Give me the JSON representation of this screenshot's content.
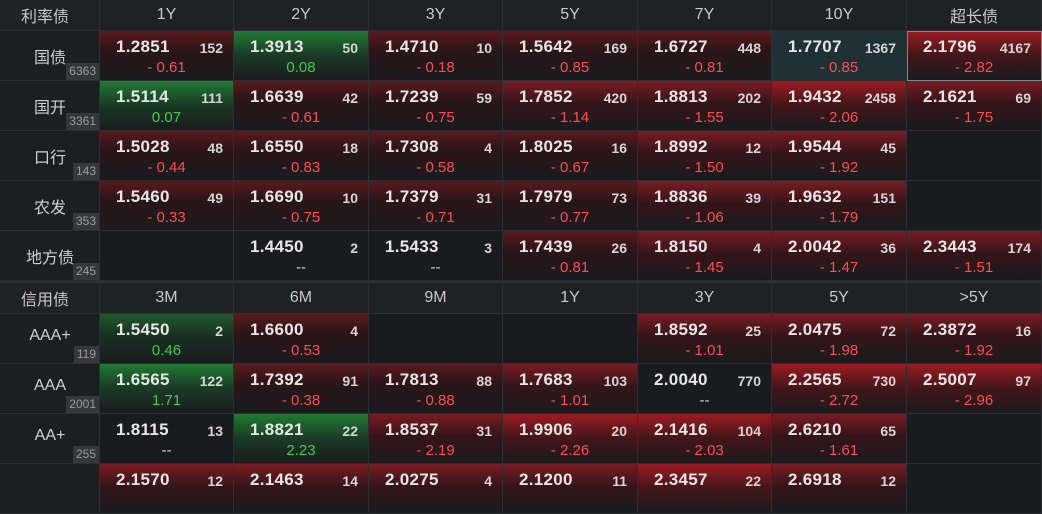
{
  "rate": {
    "title": "利率债",
    "tenors": [
      "1Y",
      "2Y",
      "3Y",
      "5Y",
      "7Y",
      "10Y",
      "超长债"
    ],
    "rows": [
      {
        "name": "国债",
        "count": "6363",
        "cells": [
          {
            "y": "1.2851",
            "v": "152",
            "c": "- 0.61",
            "d": "neg",
            "bg": "r1"
          },
          {
            "y": "1.3913",
            "v": "50",
            "c": "0.08",
            "d": "pos",
            "bg": "g2"
          },
          {
            "y": "1.4710",
            "v": "10",
            "c": "- 0.18",
            "d": "neg",
            "bg": "r1"
          },
          {
            "y": "1.5642",
            "v": "169",
            "c": "- 0.85",
            "d": "neg",
            "bg": "r1"
          },
          {
            "y": "1.6727",
            "v": "448",
            "c": "- 0.81",
            "d": "neg",
            "bg": "r1"
          },
          {
            "y": "1.7707",
            "v": "1367",
            "c": "- 0.85",
            "d": "neg",
            "bg": "r3t"
          },
          {
            "y": "2.1796",
            "v": "4167",
            "c": "- 2.82",
            "d": "neg",
            "bg": "r3s"
          }
        ]
      },
      {
        "name": "国开",
        "count": "3361",
        "cells": [
          {
            "y": "1.5114",
            "v": "111",
            "c": "0.07",
            "d": "pos",
            "bg": "g2"
          },
          {
            "y": "1.6639",
            "v": "42",
            "c": "- 0.61",
            "d": "neg",
            "bg": "r1"
          },
          {
            "y": "1.7239",
            "v": "59",
            "c": "- 0.75",
            "d": "neg",
            "bg": "r1"
          },
          {
            "y": "1.7852",
            "v": "420",
            "c": "- 1.14",
            "d": "neg",
            "bg": "r2"
          },
          {
            "y": "1.8813",
            "v": "202",
            "c": "- 1.55",
            "d": "neg",
            "bg": "r2"
          },
          {
            "y": "1.9432",
            "v": "2458",
            "c": "- 2.06",
            "d": "neg",
            "bg": "r3"
          },
          {
            "y": "2.1621",
            "v": "69",
            "c": "- 1.75",
            "d": "neg",
            "bg": "r2"
          }
        ]
      },
      {
        "name": "口行",
        "count": "143",
        "cells": [
          {
            "y": "1.5028",
            "v": "48",
            "c": "- 0.44",
            "d": "neg",
            "bg": "r1"
          },
          {
            "y": "1.6550",
            "v": "18",
            "c": "- 0.83",
            "d": "neg",
            "bg": "r1"
          },
          {
            "y": "1.7308",
            "v": "4",
            "c": "- 0.58",
            "d": "neg",
            "bg": "r1"
          },
          {
            "y": "1.8025",
            "v": "16",
            "c": "- 0.67",
            "d": "neg",
            "bg": "r1"
          },
          {
            "y": "1.8992",
            "v": "12",
            "c": "- 1.50",
            "d": "neg",
            "bg": "r2"
          },
          {
            "y": "1.9544",
            "v": "45",
            "c": "- 1.92",
            "d": "neg",
            "bg": "r2"
          },
          {
            "y": "",
            "v": "",
            "c": "",
            "d": "nil",
            "bg": "n"
          }
        ]
      },
      {
        "name": "农发",
        "count": "353",
        "cells": [
          {
            "y": "1.5460",
            "v": "49",
            "c": "- 0.33",
            "d": "neg",
            "bg": "r1"
          },
          {
            "y": "1.6690",
            "v": "10",
            "c": "- 0.75",
            "d": "neg",
            "bg": "r1"
          },
          {
            "y": "1.7379",
            "v": "31",
            "c": "- 0.71",
            "d": "neg",
            "bg": "r1"
          },
          {
            "y": "1.7979",
            "v": "73",
            "c": "- 0.77",
            "d": "neg",
            "bg": "r1"
          },
          {
            "y": "1.8836",
            "v": "39",
            "c": "- 1.06",
            "d": "neg",
            "bg": "r2"
          },
          {
            "y": "1.9632",
            "v": "151",
            "c": "- 1.79",
            "d": "neg",
            "bg": "r2"
          },
          {
            "y": "",
            "v": "",
            "c": "",
            "d": "nil",
            "bg": "n"
          }
        ]
      },
      {
        "name": "地方债",
        "count": "245",
        "cells": [
          {
            "y": "",
            "v": "",
            "c": "",
            "d": "nil",
            "bg": "n"
          },
          {
            "y": "1.4450",
            "v": "2",
            "c": "--",
            "d": "nil",
            "bg": "n"
          },
          {
            "y": "1.5433",
            "v": "3",
            "c": "--",
            "d": "nil",
            "bg": "n"
          },
          {
            "y": "1.7439",
            "v": "26",
            "c": "- 0.81",
            "d": "neg",
            "bg": "r1"
          },
          {
            "y": "1.8150",
            "v": "4",
            "c": "- 1.45",
            "d": "neg",
            "bg": "r2"
          },
          {
            "y": "2.0042",
            "v": "36",
            "c": "- 1.47",
            "d": "neg",
            "bg": "r2"
          },
          {
            "y": "2.3443",
            "v": "174",
            "c": "- 1.51",
            "d": "neg",
            "bg": "r2"
          }
        ]
      }
    ]
  },
  "credit": {
    "title": "信用债",
    "tenors": [
      "3M",
      "6M",
      "9M",
      "1Y",
      "3Y",
      "5Y",
      ">5Y"
    ],
    "rows": [
      {
        "name": "AAA+",
        "count": "119",
        "cells": [
          {
            "y": "1.5450",
            "v": "2",
            "c": "0.46",
            "d": "pos",
            "bg": "g1"
          },
          {
            "y": "1.6600",
            "v": "4",
            "c": "- 0.53",
            "d": "neg",
            "bg": "r1"
          },
          {
            "y": "",
            "v": "",
            "c": "",
            "d": "nil",
            "bg": "n"
          },
          {
            "y": "",
            "v": "",
            "c": "",
            "d": "nil",
            "bg": "n"
          },
          {
            "y": "1.8592",
            "v": "25",
            "c": "- 1.01",
            "d": "neg",
            "bg": "r2"
          },
          {
            "y": "2.0475",
            "v": "72",
            "c": "- 1.98",
            "d": "neg",
            "bg": "r2"
          },
          {
            "y": "2.3872",
            "v": "16",
            "c": "- 1.92",
            "d": "neg",
            "bg": "r2"
          }
        ]
      },
      {
        "name": "AAA",
        "count": "2001",
        "cells": [
          {
            "y": "1.6565",
            "v": "122",
            "c": "1.71",
            "d": "pos",
            "bg": "g2"
          },
          {
            "y": "1.7392",
            "v": "91",
            "c": "- 0.38",
            "d": "neg",
            "bg": "r1"
          },
          {
            "y": "1.7813",
            "v": "88",
            "c": "- 0.88",
            "d": "neg",
            "bg": "r1"
          },
          {
            "y": "1.7683",
            "v": "103",
            "c": "- 1.01",
            "d": "neg",
            "bg": "r2"
          },
          {
            "y": "2.0040",
            "v": "770",
            "c": "--",
            "d": "nil",
            "bg": "n"
          },
          {
            "y": "2.2565",
            "v": "730",
            "c": "- 2.72",
            "d": "neg",
            "bg": "r3"
          },
          {
            "y": "2.5007",
            "v": "97",
            "c": "- 2.96",
            "d": "neg",
            "bg": "r3"
          }
        ]
      },
      {
        "name": "AA+",
        "count": "255",
        "cells": [
          {
            "y": "1.8115",
            "v": "13",
            "c": "--",
            "d": "nil",
            "bg": "n"
          },
          {
            "y": "1.8821",
            "v": "22",
            "c": "2.23",
            "d": "pos",
            "bg": "g2"
          },
          {
            "y": "1.8537",
            "v": "31",
            "c": "- 2.19",
            "d": "neg",
            "bg": "r2"
          },
          {
            "y": "1.9906",
            "v": "20",
            "c": "- 2.26",
            "d": "neg",
            "bg": "r3"
          },
          {
            "y": "2.1416",
            "v": "104",
            "c": "- 2.03",
            "d": "neg",
            "bg": "r3"
          },
          {
            "y": "2.6210",
            "v": "65",
            "c": "- 1.61",
            "d": "neg",
            "bg": "r2"
          },
          {
            "y": "",
            "v": "",
            "c": "",
            "d": "nil",
            "bg": "n"
          }
        ]
      },
      {
        "name": "",
        "count": "",
        "cells": [
          {
            "y": "2.1570",
            "v": "12",
            "c": "",
            "d": "nil",
            "bg": "r2"
          },
          {
            "y": "2.1463",
            "v": "14",
            "c": "",
            "d": "nil",
            "bg": "r2"
          },
          {
            "y": "2.0275",
            "v": "4",
            "c": "",
            "d": "nil",
            "bg": "r2"
          },
          {
            "y": "2.1200",
            "v": "11",
            "c": "",
            "d": "nil",
            "bg": "r2"
          },
          {
            "y": "2.3457",
            "v": "22",
            "c": "",
            "d": "nil",
            "bg": "r3"
          },
          {
            "y": "2.6918",
            "v": "12",
            "c": "",
            "d": "nil",
            "bg": "r2"
          },
          {
            "y": "",
            "v": "",
            "c": "",
            "d": "nil",
            "bg": "n"
          }
        ]
      }
    ]
  }
}
